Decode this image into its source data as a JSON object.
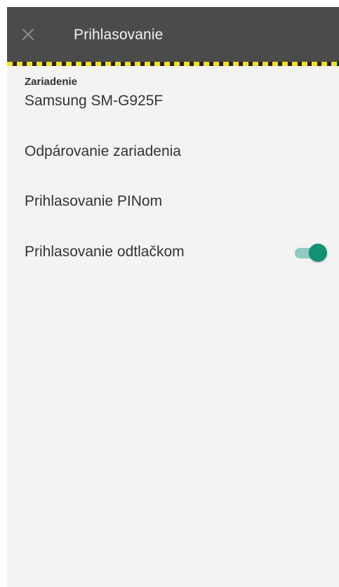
{
  "toolbar": {
    "title": "Prihlasovanie",
    "close_icon": "close-icon"
  },
  "device": {
    "label": "Zariadenie",
    "name": "Samsung SM-G925F"
  },
  "menu": {
    "unpair_label": "Odpárovanie zariadenia",
    "pin_label": "Prihlasovanie PINom",
    "fingerprint_label": "Prihlasovanie odtlačkom",
    "fingerprint_enabled": true
  },
  "colors": {
    "toolbar_background": "#4b4b49",
    "toolbar_stripe_yellow": "#f2df1e",
    "page_background": "#f3f3f3",
    "text": "#333333",
    "toggle_thumb": "#129173",
    "toggle_track": "#8fcbc2"
  }
}
